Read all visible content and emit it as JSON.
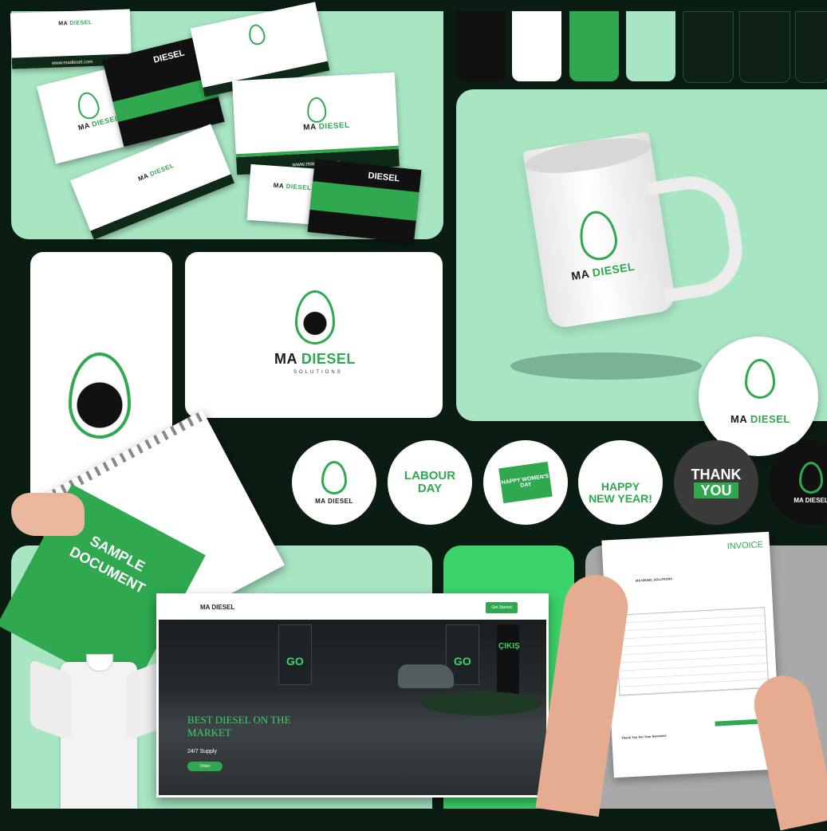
{
  "brand": {
    "name_prefix": "MA",
    "name_main": "DIESEL",
    "tagline": "SOLUTIONS",
    "short_name": "DIESEL",
    "website": "www.madiesel.com"
  },
  "colors": {
    "mint": "#a8e6c3",
    "dark": "#0b1c12",
    "green": "#2fa84f",
    "bright_green": "#3bd36a",
    "white": "#ffffff",
    "black": "#111111"
  },
  "swatches": [
    "#111111",
    "#ffffff",
    "#2fa84f",
    "#a8e6c3",
    "#0e2016",
    "#0e2016",
    "#0e2016"
  ],
  "stickers": [
    {
      "type": "logo",
      "label": "MA DIESEL"
    },
    {
      "type": "labour_day",
      "title_line1": "LABOUR",
      "title_line2": "DAY"
    },
    {
      "type": "womens_day",
      "text": "HAPPY WOMEN'S DAY"
    },
    {
      "type": "new_year",
      "text_line1": "HAPPY",
      "text_line2": "NEW YEAR!"
    },
    {
      "type": "thank_you",
      "text_line1": "THANK",
      "text_line2": "YOU"
    },
    {
      "type": "logo_dark",
      "label": "MA DIESEL"
    }
  ],
  "notebook": {
    "title_line1": "SAMPLE",
    "title_line2": "DOCUMENT"
  },
  "website": {
    "nav_brand": "MA DIESEL",
    "nav_button": "Get Started",
    "hero_title_line1": "BEST DIESEL ON THE",
    "hero_title_line2": "MARKET",
    "hero_sub": "24/7 Supply",
    "hero_button": "Order",
    "sign_go": "GO",
    "sign_exit": "ÇIKIŞ"
  },
  "invoice": {
    "title": "INVOICE",
    "company": "MA DIESEL SOLUTIONS",
    "footer": "Thank You For Your Business"
  }
}
